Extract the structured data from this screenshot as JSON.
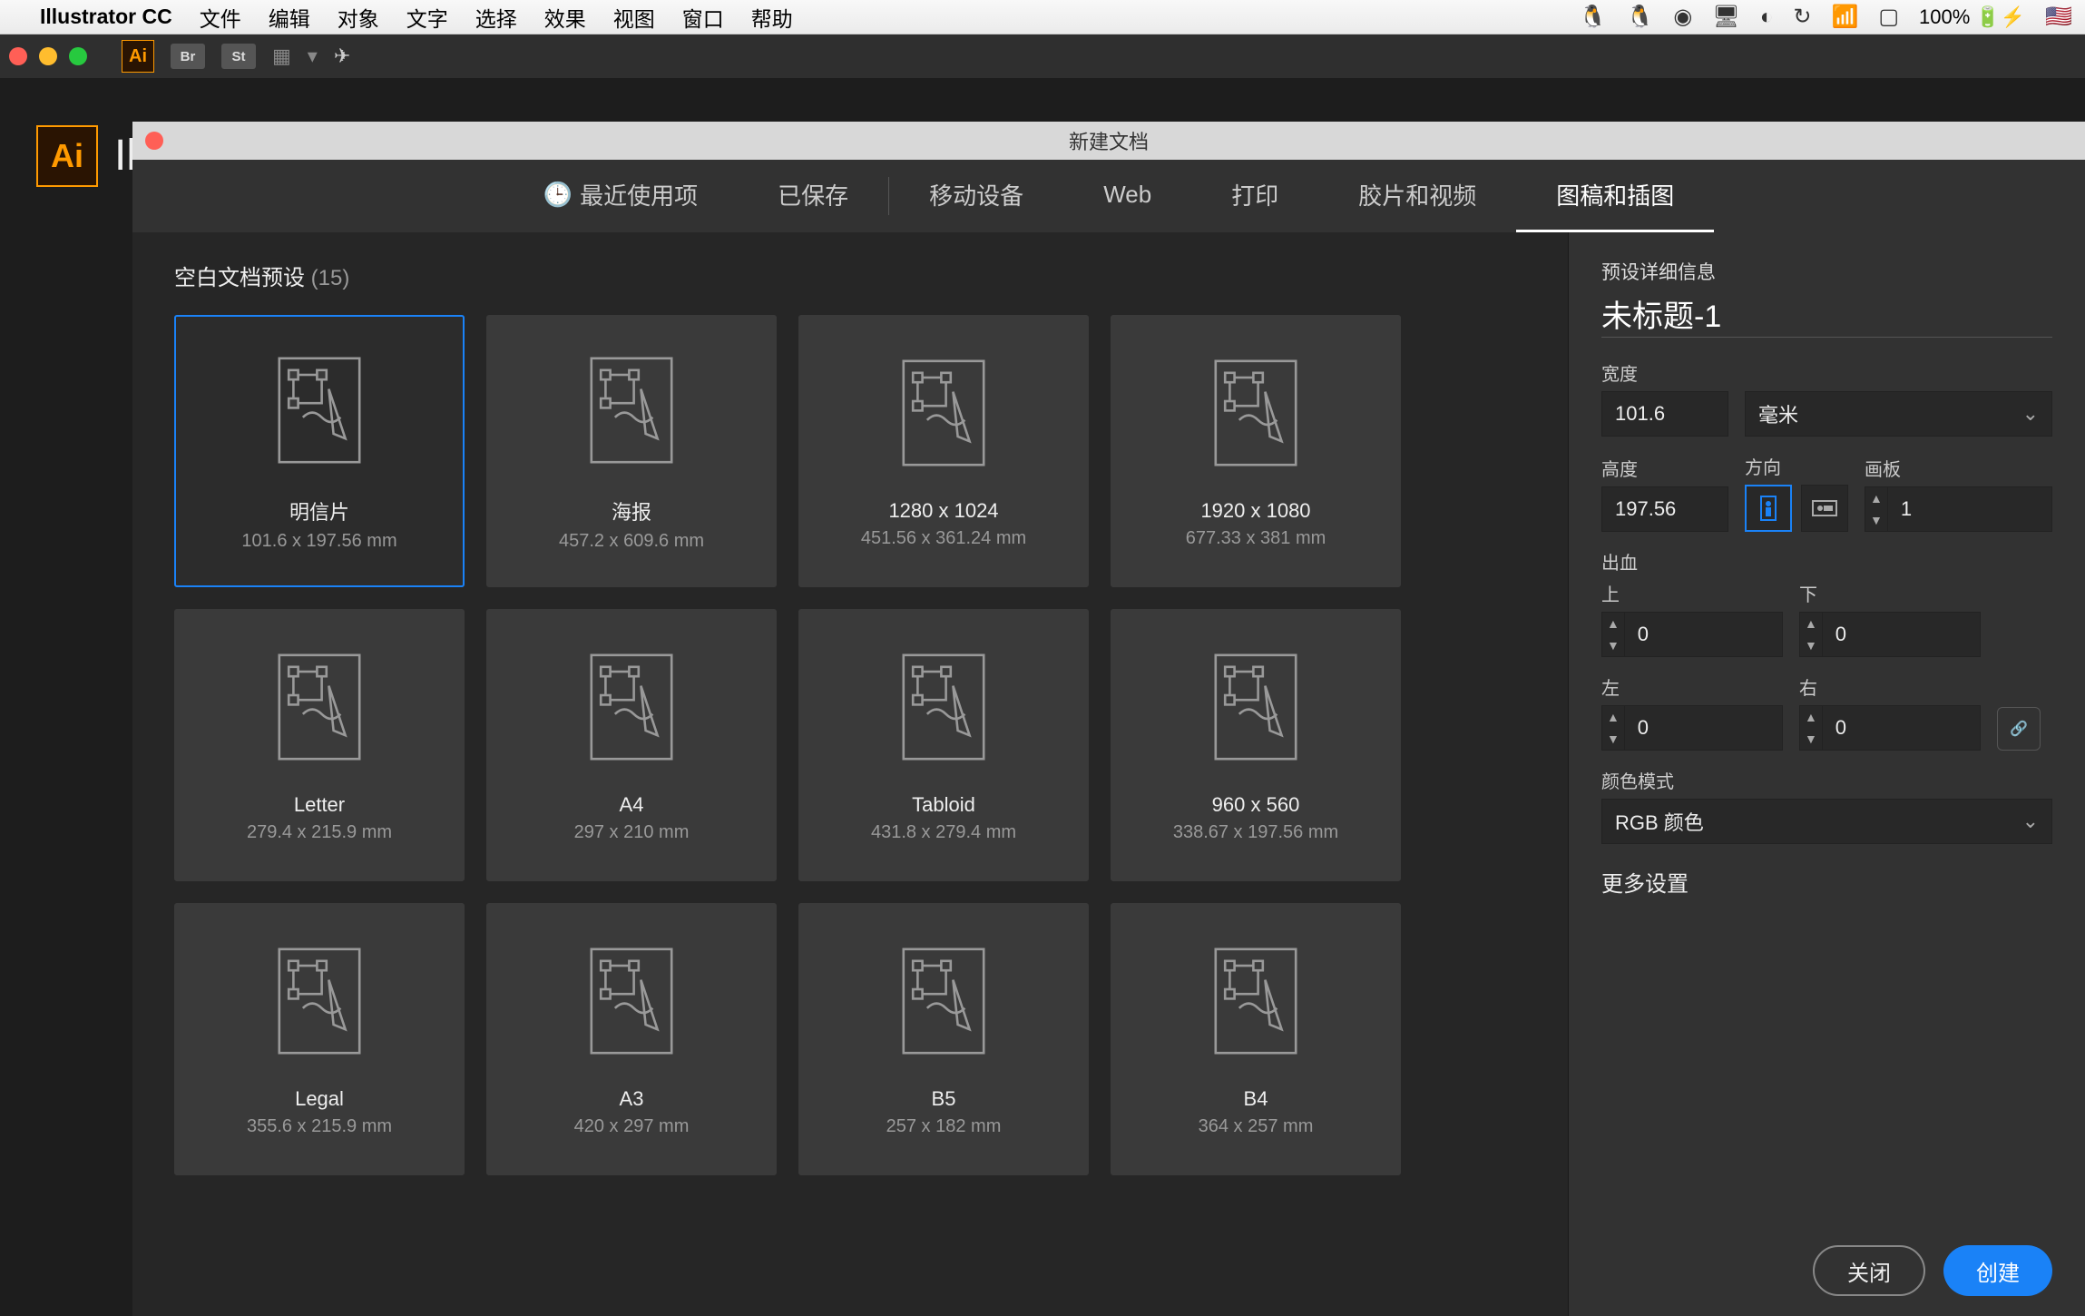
{
  "macos": {
    "app_name": "Illustrator CC",
    "menus": [
      "文件",
      "编辑",
      "对象",
      "文字",
      "选择",
      "效果",
      "视图",
      "窗口",
      "帮助"
    ],
    "battery": "100%"
  },
  "appbar": {
    "chips": [
      "Br",
      "St"
    ]
  },
  "ai_title_partial": "Ill",
  "dialog": {
    "title": "新建文档",
    "tabs": {
      "recent": "最近使用项",
      "saved": "已保存",
      "mobile": "移动设备",
      "web": "Web",
      "print": "打印",
      "film": "胶片和视频",
      "art": "图稿和插图"
    },
    "presets_heading": "空白文档预设",
    "presets_count": "(15)",
    "presets": [
      {
        "name": "明信片",
        "dims": "101.6 x 197.56 mm",
        "selected": true
      },
      {
        "name": "海报",
        "dims": "457.2 x 609.6 mm",
        "selected": false
      },
      {
        "name": "1280 x 1024",
        "dims": "451.56 x 361.24 mm",
        "selected": false
      },
      {
        "name": "1920 x 1080",
        "dims": "677.33 x 381 mm",
        "selected": false
      },
      {
        "name": "Letter",
        "dims": "279.4 x 215.9 mm",
        "selected": false
      },
      {
        "name": "A4",
        "dims": "297 x 210 mm",
        "selected": false
      },
      {
        "name": "Tabloid",
        "dims": "431.8 x 279.4 mm",
        "selected": false
      },
      {
        "name": "960 x 560",
        "dims": "338.67 x 197.56 mm",
        "selected": false
      },
      {
        "name": "Legal",
        "dims": "355.6 x 215.9 mm",
        "selected": false
      },
      {
        "name": "A3",
        "dims": "420 x 297 mm",
        "selected": false
      },
      {
        "name": "B5",
        "dims": "257 x 182 mm",
        "selected": false
      },
      {
        "name": "B4",
        "dims": "364 x 257 mm",
        "selected": false
      }
    ]
  },
  "details": {
    "heading": "预设详细信息",
    "doc_name": "未标题-1",
    "labels": {
      "width": "宽度",
      "height": "高度",
      "orientation": "方向",
      "artboards": "画板",
      "bleed": "出血",
      "top": "上",
      "bottom": "下",
      "left": "左",
      "right": "右",
      "color_mode": "颜色模式",
      "more": "更多设置"
    },
    "values": {
      "width": "101.6",
      "height": "197.56",
      "unit": "毫米",
      "artboards": "1",
      "bleed_top": "0",
      "bleed_bottom": "0",
      "bleed_left": "0",
      "bleed_right": "0",
      "color_mode": "RGB 颜色"
    },
    "buttons": {
      "close": "关闭",
      "create": "创建"
    }
  }
}
